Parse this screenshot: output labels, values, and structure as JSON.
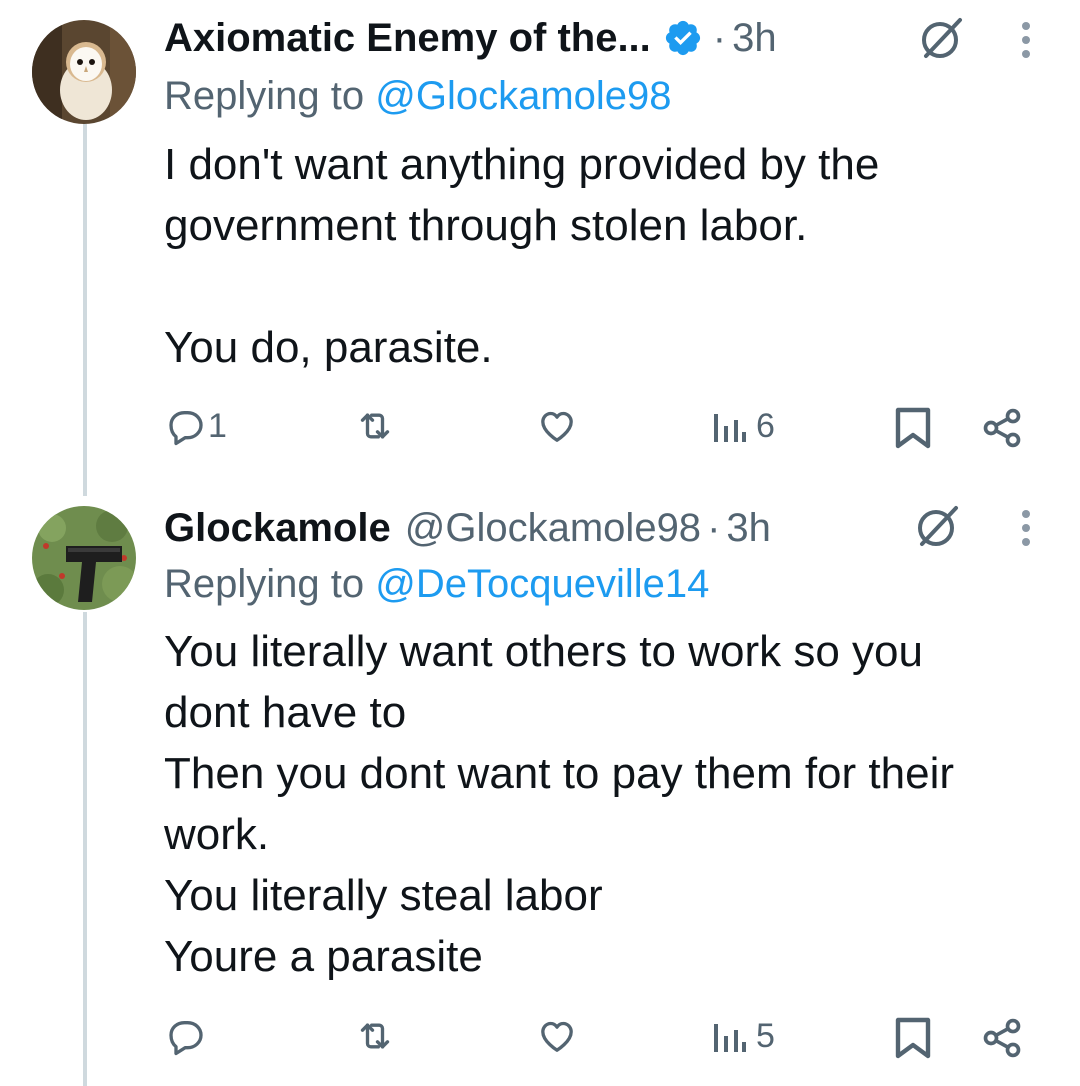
{
  "tweets": [
    {
      "name": "Axiomatic Enemy of the...",
      "handle": "",
      "time": "3h",
      "verified": true,
      "replying_prefix": "Replying to",
      "replying_to": "@Glockamole98",
      "text": "I don't want anything provided by the\ngovernment through stolen labor.\n\nYou do, parasite.",
      "replies": "1",
      "retweets": "",
      "likes": "",
      "views": "6"
    },
    {
      "name": "Glockamole",
      "handle": "@Glockamole98",
      "time": "3h",
      "verified": false,
      "replying_prefix": "Replying to",
      "replying_to": "@DeTocqueville14",
      "text": "You literally want others to work so you\ndont have to\nThen you dont want to pay them for their\nwork.\nYou literally steal labor\nYoure a parasite",
      "replies": "",
      "retweets": "",
      "likes": "",
      "views": "5"
    }
  ],
  "colors": {
    "text": "#0f1419",
    "secondary": "#536471",
    "link": "#1d9bf0",
    "thread_line": "#cfd9de"
  },
  "icons": [
    "verified-badge-icon",
    "grok-icon",
    "more-icon",
    "reply-icon",
    "retweet-icon",
    "like-icon",
    "views-icon",
    "bookmark-icon",
    "share-icon"
  ]
}
